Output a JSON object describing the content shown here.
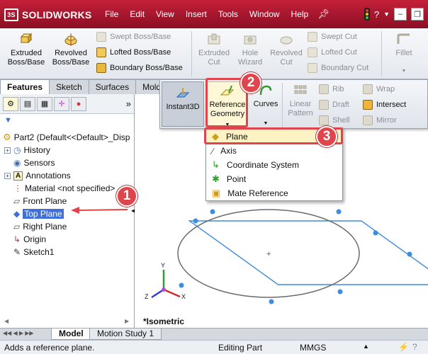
{
  "app": {
    "brand": "SOLIDWORKS",
    "brand_mark": "3S"
  },
  "menu": [
    "File",
    "Edit",
    "View",
    "Insert",
    "Tools",
    "Window",
    "Help"
  ],
  "ribbon": {
    "extruded_boss": "Extruded\nBoss/Base",
    "revolved_boss": "Revolved\nBoss/Base",
    "swept_boss": "Swept Boss/Base",
    "lofted_boss": "Lofted Boss/Base",
    "boundary_boss": "Boundary Boss/Base",
    "extruded_cut": "Extruded\nCut",
    "hole_wizard": "Hole\nWizard",
    "revolved_cut": "Revolved\nCut",
    "swept_cut": "Swept Cut",
    "lofted_cut": "Lofted Cut",
    "boundary_cut": "Boundary Cut",
    "fillet": "Fillet"
  },
  "tabs": [
    "Features",
    "Sketch",
    "Surfaces",
    "Mold"
  ],
  "features_bar": {
    "instant3d": "Instant3D",
    "reference_geometry": "Reference\nGeometry",
    "curves": "Curves",
    "linear_pattern": "Linear\nPattern",
    "rib": "Rib",
    "draft": "Draft",
    "shell": "Shell",
    "wrap": "Wrap",
    "intersect": "Intersect",
    "mirror": "Mirror"
  },
  "dropdown": [
    "Plane",
    "Axis",
    "Coordinate System",
    "Point",
    "Mate Reference"
  ],
  "tree": {
    "root": "Part2  (Default<<Default>_Disp",
    "items": [
      "History",
      "Sensors",
      "Annotations",
      "Material <not specified>",
      "Front Plane",
      "Top Plane",
      "Right Plane",
      "Origin",
      "Sketch1"
    ]
  },
  "callouts": [
    "1",
    "2",
    "3"
  ],
  "view_label": "*Isometric",
  "axis_labels": {
    "x": "X",
    "y": "Y",
    "z": "Z"
  },
  "bottom_tabs": [
    "Model",
    "Motion Study 1"
  ],
  "status": {
    "message": "Adds a reference plane.",
    "mode": "Editing Part",
    "units": "MMGS"
  },
  "colors": {
    "brand_red": "#b8162e",
    "callout_red": "#e0454b",
    "selection_blue": "#3f6fd8",
    "plane_blue": "#3c8ce0",
    "highlight_yellow": "#fdf2c4"
  }
}
